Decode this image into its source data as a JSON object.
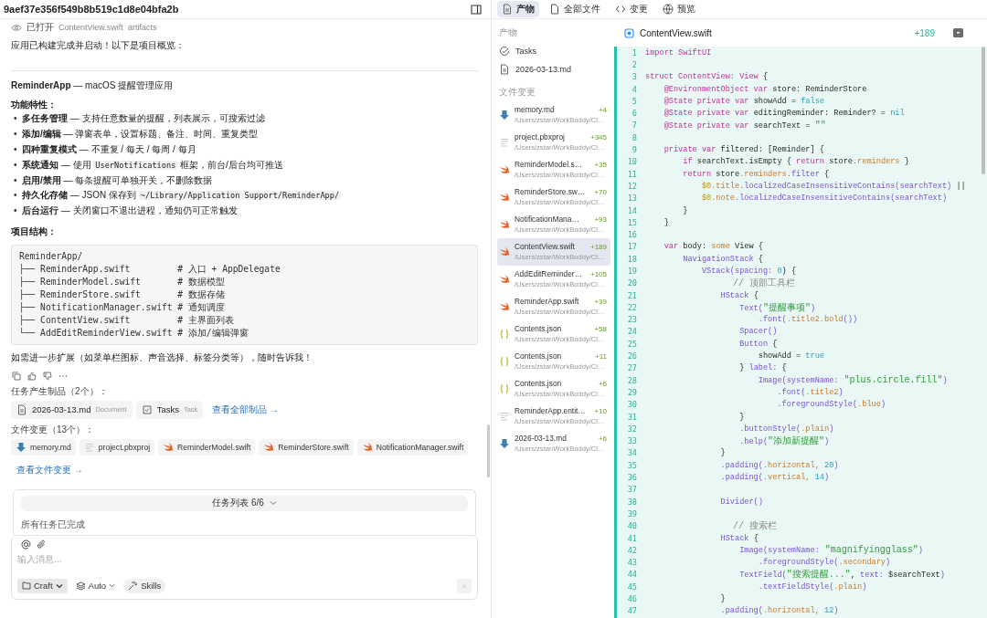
{
  "session_title": "9aef37e356f549b8b519c1d8e04bfa2b",
  "opened": {
    "label": "已打开",
    "file": "ContentView.swift",
    "tag": "artifacts"
  },
  "intro": "应用已构建完成并启动！以下是项目概览：",
  "app_heading": [
    {
      "kind": "bold",
      "text": "ReminderApp"
    },
    {
      "kind": "text",
      "text": " — macOS 提醒管理应用"
    }
  ],
  "features_heading": "功能特性：",
  "features": [
    {
      "marker": "•",
      "parts": [
        {
          "kind": "bold",
          "text": "多任务管理"
        },
        {
          "kind": "text",
          "text": " — 支持任意数量的提醒，列表展示，可搜索过滤"
        }
      ]
    },
    {
      "marker": "•",
      "parts": [
        {
          "kind": "bold",
          "text": "添加/编辑"
        },
        {
          "kind": "text",
          "text": " — 弹窗表单，设置标题、备注、时间、重复类型"
        }
      ]
    },
    {
      "marker": "•",
      "parts": [
        {
          "kind": "bold",
          "text": "四种重复模式"
        },
        {
          "kind": "text",
          "text": " — 不重复 / 每天 / 每周 / 每月"
        }
      ]
    },
    {
      "marker": "•",
      "parts": [
        {
          "kind": "bold",
          "text": "系统通知"
        },
        {
          "kind": "text",
          "text": " — 使用 "
        },
        {
          "kind": "code",
          "text": "UserNotifications"
        },
        {
          "kind": "text",
          "text": " 框架，前台/后台均可推送"
        }
      ]
    },
    {
      "marker": "•",
      "parts": [
        {
          "kind": "bold",
          "text": "启用/禁用"
        },
        {
          "kind": "text",
          "text": " — 每条提醒可单独开关，不删除数据"
        }
      ]
    },
    {
      "marker": "•",
      "parts": [
        {
          "kind": "bold",
          "text": "持久化存储"
        },
        {
          "kind": "text",
          "text": " — JSON 保存到 "
        },
        {
          "kind": "code",
          "text": "~/Library/Application Support/ReminderApp/"
        }
      ]
    },
    {
      "marker": "•",
      "parts": [
        {
          "kind": "bold",
          "text": "后台运行"
        },
        {
          "kind": "text",
          "text": " — 关闭窗口不退出进程，通知仍可正常触发"
        }
      ]
    }
  ],
  "structure_heading": "项目结构：",
  "tree": [
    "ReminderApp/",
    "├── ReminderApp.swift         # 入口 + AppDelegate",
    "├── ReminderModel.swift       # 数据模型",
    "├── ReminderStore.swift       # 数据存储",
    "├── NotificationManager.swift # 通知调度",
    "├── ContentView.swift         # 主界面列表",
    "└── AddEditReminderView.swift # 添加/编辑弹窗"
  ],
  "closing": "如需进一步扩展（如菜单栏图标、声音选择、标签分类等），随时告诉我！",
  "artifacts": {
    "heading": "任务产生制品（2个）：",
    "items": [
      {
        "name": "2026-03-13.md",
        "type": "Document",
        "kind": "doc"
      },
      {
        "name": "Tasks",
        "type": "Task",
        "kind": "task"
      }
    ],
    "link": "查看全部制品 →"
  },
  "changes": {
    "heading": "文件变更（13个）：",
    "items": [
      {
        "name": "memory.md",
        "kind": "md"
      },
      {
        "name": "project.pbxproj",
        "kind": "generic"
      },
      {
        "name": "ReminderModel.swift",
        "kind": "swift"
      },
      {
        "name": "ReminderStore.swift",
        "kind": "swift"
      },
      {
        "name": "NotificationManager.swift",
        "kind": "swift"
      }
    ],
    "link": "查看文件变更 →"
  },
  "task_list": {
    "title": "任务列表 6/6",
    "status": "所有任务已完成"
  },
  "composer": {
    "placeholder": "输入消息...",
    "mode": "Craft",
    "model": "Auto",
    "skills": "Skills"
  },
  "tabs": [
    {
      "label": "产物",
      "kind": "doc",
      "selected": true
    },
    {
      "label": "全部文件",
      "kind": "file",
      "selected": false
    },
    {
      "label": "变更",
      "kind": "code",
      "selected": false
    },
    {
      "label": "预览",
      "kind": "globe",
      "selected": false
    }
  ],
  "sidebar": {
    "artifacts_heading": "产物",
    "artifacts": [
      {
        "name": "Tasks",
        "kind": "todo"
      },
      {
        "name": "2026-03-13.md",
        "kind": "doc"
      }
    ],
    "changes_heading": "文件变更",
    "files": [
      {
        "name": "memory.md",
        "path": "/Users/zstar/WorkBuddy/Cl…",
        "added": "+4",
        "kind": "md",
        "selected": false
      },
      {
        "name": "project.pbxproj",
        "path": "/Users/zstar/WorkBuddy/Cl…",
        "added": "+345",
        "kind": "generic",
        "selected": false
      },
      {
        "name": "ReminderModel.s…",
        "path": "/Users/zstar/WorkBuddy/Cl…",
        "added": "+35",
        "kind": "swift",
        "selected": false
      },
      {
        "name": "ReminderStore.sw…",
        "path": "/Users/zstar/WorkBuddy/Cl…",
        "added": "+70",
        "kind": "swift",
        "selected": false
      },
      {
        "name": "NotificationMana…",
        "path": "/Users/zstar/WorkBuddy/Cl…",
        "added": "+93",
        "kind": "swift",
        "selected": false
      },
      {
        "name": "ContentView.swift",
        "path": "/Users/zstar/WorkBuddy/Cl…",
        "added": "+189",
        "kind": "swift",
        "selected": true
      },
      {
        "name": "AddEditReminder…",
        "path": "/Users/zstar/WorkBuddy/Cl…",
        "added": "+105",
        "kind": "swift",
        "selected": false
      },
      {
        "name": "ReminderApp.swift",
        "path": "/Users/zstar/WorkBuddy/Cl…",
        "added": "+39",
        "kind": "swift",
        "selected": false
      },
      {
        "name": "Contents.json",
        "path": "/Users/zstar/WorkBuddy/Cl…",
        "added": "+58",
        "kind": "json",
        "selected": false
      },
      {
        "name": "Contents.json",
        "path": "/Users/zstar/WorkBuddy/Cl…",
        "added": "+11",
        "kind": "json",
        "selected": false
      },
      {
        "name": "Contents.json",
        "path": "/Users/zstar/WorkBuddy/Cl…",
        "added": "+6",
        "kind": "json",
        "selected": false
      },
      {
        "name": "ReminderApp.entit…",
        "path": "/Users/zstar/WorkBuddy/Cl…",
        "added": "+10",
        "kind": "generic",
        "selected": false
      },
      {
        "name": "2026-03-13.md",
        "path": "/Users/zstar/WorkBuddy/Cl…",
        "added": "+6",
        "kind": "md",
        "selected": false
      }
    ]
  },
  "editor": {
    "file": "ContentView.swift",
    "added": "+189",
    "lines": [
      {
        "number": "1",
        "tokens": [
          {
            "kind": "kw",
            "text": "import SwiftUI"
          }
        ]
      },
      {
        "number": "2"
      },
      {
        "number": "3",
        "tokens": [
          {
            "kind": "kw",
            "text": "struct ContentView: View"
          },
          {
            "kind": "plain",
            "text": " {"
          }
        ]
      },
      {
        "number": "4",
        "tokens": [
          {
            "kind": "kw",
            "text": "    @EnvironmentObject var"
          },
          {
            "kind": "plain",
            "text": " store: ReminderStore"
          }
        ]
      },
      {
        "number": "5",
        "tokens": [
          {
            "kind": "kw",
            "text": "    @State private var"
          },
          {
            "kind": "plain",
            "text": " showAdd = "
          },
          {
            "kind": "lit",
            "text": "false"
          }
        ]
      },
      {
        "number": "6",
        "tokens": [
          {
            "kind": "kw",
            "text": "    @State private var"
          },
          {
            "kind": "plain",
            "text": " editingReminder: Reminder? = "
          },
          {
            "kind": "lit",
            "text": "nil"
          }
        ]
      },
      {
        "number": "7",
        "tokens": [
          {
            "kind": "kw",
            "text": "    @State private var"
          },
          {
            "kind": "plain",
            "text": " searchText = "
          },
          {
            "kind": "str",
            "text": "\"\""
          }
        ]
      },
      {
        "number": "8"
      },
      {
        "number": "9",
        "tokens": [
          {
            "kind": "kw",
            "text": "    private var"
          },
          {
            "kind": "plain",
            "text": " filtered: [Reminder] {"
          }
        ]
      },
      {
        "number": "10",
        "tokens": [
          {
            "kind": "kw",
            "text": "        if"
          },
          {
            "kind": "plain",
            "text": " searchText.isEmpty { "
          },
          {
            "kind": "kw",
            "text": "return"
          },
          {
            "kind": "plain",
            "text": " store"
          },
          {
            "kind": "prop",
            "text": ".reminders"
          },
          {
            "kind": "plain",
            "text": " }"
          }
        ]
      },
      {
        "number": "11",
        "tokens": [
          {
            "kind": "kw",
            "text": "        return"
          },
          {
            "kind": "plain",
            "text": " store"
          },
          {
            "kind": "prop",
            "text": ".reminders"
          },
          {
            "kind": "type",
            "text": ".filter"
          },
          {
            "kind": "plain",
            "text": " {"
          }
        ]
      },
      {
        "number": "12",
        "tokens": [
          {
            "kind": "var",
            "text": "            $0"
          },
          {
            "kind": "prop",
            "text": ".title"
          },
          {
            "kind": "type",
            "text": ".localizedCaseInsensitiveContains(searchText)"
          },
          {
            "kind": "plain",
            "text": " ||"
          }
        ]
      },
      {
        "number": "13",
        "tokens": [
          {
            "kind": "var",
            "text": "            $0"
          },
          {
            "kind": "prop",
            "text": ".note"
          },
          {
            "kind": "type",
            "text": ".localizedCaseInsensitiveContains(searchText)"
          }
        ]
      },
      {
        "number": "14",
        "tokens": [
          {
            "kind": "plain",
            "text": "        }"
          }
        ]
      },
      {
        "number": "15",
        "tokens": [
          {
            "kind": "plain",
            "text": "    }"
          }
        ]
      },
      {
        "number": "16"
      },
      {
        "number": "17",
        "tokens": [
          {
            "kind": "kw",
            "text": "    var"
          },
          {
            "kind": "plain",
            "text": " body: "
          },
          {
            "kind": "prop",
            "text": "some"
          },
          {
            "kind": "plain",
            "text": " View {"
          }
        ]
      },
      {
        "number": "18",
        "tokens": [
          {
            "kind": "type",
            "text": "        NavigationStack"
          },
          {
            "kind": "plain",
            "text": " {"
          }
        ]
      },
      {
        "number": "19",
        "tokens": [
          {
            "kind": "type",
            "text": "            VStack(spacing:"
          },
          {
            "kind": "lit",
            "text": " 0"
          },
          {
            "kind": "plain",
            "text": ") {"
          }
        ]
      },
      {
        "number": "20",
        "tokens": [
          {
            "kind": "comment",
            "text": "                // 顶部工具栏"
          }
        ]
      },
      {
        "number": "21",
        "tokens": [
          {
            "kind": "type",
            "text": "                HStack"
          },
          {
            "kind": "plain",
            "text": " {"
          }
        ]
      },
      {
        "number": "22",
        "tokens": [
          {
            "kind": "type",
            "text": "                    Text("
          },
          {
            "kind": "str",
            "text": "\"提醒事项\""
          },
          {
            "kind": "type",
            "text": ")"
          }
        ]
      },
      {
        "number": "23",
        "tokens": [
          {
            "kind": "type",
            "text": "                        .font("
          },
          {
            "kind": "prop",
            "text": ".title2.bold"
          },
          {
            "kind": "type",
            "text": "())"
          }
        ]
      },
      {
        "number": "24",
        "tokens": [
          {
            "kind": "type",
            "text": "                    Spacer()"
          }
        ]
      },
      {
        "number": "25",
        "tokens": [
          {
            "kind": "type",
            "text": "                    Button"
          },
          {
            "kind": "plain",
            "text": " {"
          }
        ]
      },
      {
        "number": "26",
        "tokens": [
          {
            "kind": "plain",
            "text": "                        showAdd = "
          },
          {
            "kind": "lit",
            "text": "true"
          }
        ]
      },
      {
        "number": "27",
        "tokens": [
          {
            "kind": "plain",
            "text": "                    } "
          },
          {
            "kind": "type",
            "text": "label:"
          },
          {
            "kind": "plain",
            "text": " {"
          }
        ]
      },
      {
        "number": "28",
        "tokens": [
          {
            "kind": "type",
            "text": "                        Image(systemName:"
          },
          {
            "kind": "str",
            "text": " \"plus.circle.fill\""
          },
          {
            "kind": "type",
            "text": ")"
          }
        ]
      },
      {
        "number": "29",
        "tokens": [
          {
            "kind": "type",
            "text": "                            .font("
          },
          {
            "kind": "prop",
            "text": ".title2"
          },
          {
            "kind": "type",
            "text": ")"
          }
        ]
      },
      {
        "number": "30",
        "tokens": [
          {
            "kind": "type",
            "text": "                            .foregroundStyle("
          },
          {
            "kind": "prop",
            "text": ".blue"
          },
          {
            "kind": "type",
            "text": ")"
          }
        ]
      },
      {
        "number": "31",
        "tokens": [
          {
            "kind": "plain",
            "text": "                    }"
          }
        ]
      },
      {
        "number": "32",
        "tokens": [
          {
            "kind": "type",
            "text": "                    .buttonStyle("
          },
          {
            "kind": "prop",
            "text": ".plain"
          },
          {
            "kind": "type",
            "text": ")"
          }
        ]
      },
      {
        "number": "33",
        "tokens": [
          {
            "kind": "type",
            "text": "                    .help("
          },
          {
            "kind": "str",
            "text": "\"添加新提醒\""
          },
          {
            "kind": "type",
            "text": ")"
          }
        ]
      },
      {
        "number": "34",
        "tokens": [
          {
            "kind": "plain",
            "text": "                }"
          }
        ]
      },
      {
        "number": "35",
        "tokens": [
          {
            "kind": "type",
            "text": "                .padding("
          },
          {
            "kind": "prop",
            "text": ".horizontal,"
          },
          {
            "kind": "lit",
            "text": " 20"
          },
          {
            "kind": "type",
            "text": ")"
          }
        ]
      },
      {
        "number": "36",
        "tokens": [
          {
            "kind": "type",
            "text": "                .padding("
          },
          {
            "kind": "prop",
            "text": ".vertical,"
          },
          {
            "kind": "lit",
            "text": " 14"
          },
          {
            "kind": "type",
            "text": ")"
          }
        ]
      },
      {
        "number": "37"
      },
      {
        "number": "38",
        "tokens": [
          {
            "kind": "type",
            "text": "                Divider()"
          }
        ]
      },
      {
        "number": "39"
      },
      {
        "number": "40",
        "tokens": [
          {
            "kind": "comment",
            "text": "                // 搜索栏"
          }
        ]
      },
      {
        "number": "41",
        "tokens": [
          {
            "kind": "type",
            "text": "                HStack"
          },
          {
            "kind": "plain",
            "text": " {"
          }
        ]
      },
      {
        "number": "42",
        "tokens": [
          {
            "kind": "type",
            "text": "                    Image(systemName:"
          },
          {
            "kind": "str",
            "text": " \"magnifyingglass\""
          },
          {
            "kind": "type",
            "text": ")"
          }
        ]
      },
      {
        "number": "43",
        "tokens": [
          {
            "kind": "type",
            "text": "                        .foregroundStyle("
          },
          {
            "kind": "prop",
            "text": ".secondary"
          },
          {
            "kind": "type",
            "text": ")"
          }
        ]
      },
      {
        "number": "44",
        "tokens": [
          {
            "kind": "type",
            "text": "                    TextField("
          },
          {
            "kind": "str",
            "text": "\"搜索提醒...\""
          },
          {
            "kind": "plain",
            "text": ", "
          },
          {
            "kind": "type",
            "text": "text:"
          },
          {
            "kind": "plain",
            "text": " $searchText"
          },
          {
            "kind": "type",
            "text": ")"
          }
        ]
      },
      {
        "number": "45",
        "tokens": [
          {
            "kind": "type",
            "text": "                        .textFieldStyle("
          },
          {
            "kind": "prop",
            "text": ".plain"
          },
          {
            "kind": "type",
            "text": ")"
          }
        ]
      },
      {
        "number": "46",
        "tokens": [
          {
            "kind": "plain",
            "text": "                }"
          }
        ]
      },
      {
        "number": "47",
        "tokens": [
          {
            "kind": "type",
            "text": "                .padding("
          },
          {
            "kind": "prop",
            "text": ".horizontal,"
          },
          {
            "kind": "lit",
            "text": " 12"
          },
          {
            "kind": "type",
            "text": ")"
          }
        ]
      }
    ]
  }
}
